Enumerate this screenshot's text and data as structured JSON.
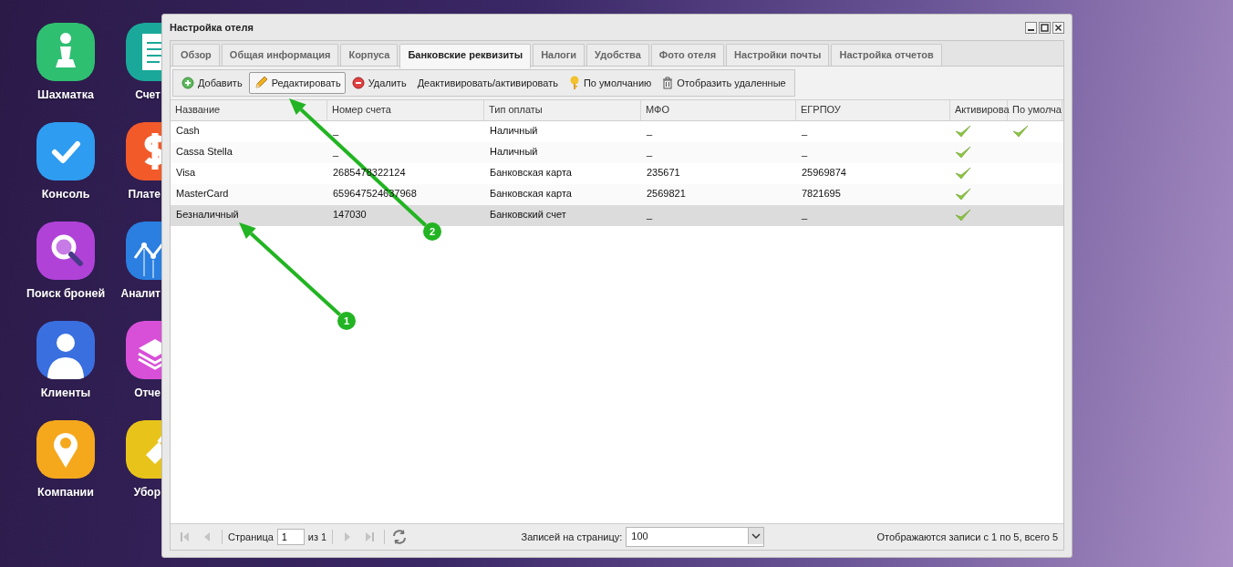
{
  "desktop": {
    "icons": [
      {
        "label": "Шахматка",
        "color": "#2fbf71"
      },
      {
        "label": "Счет",
        "color": "#1aa89a"
      },
      {
        "label": "Консоль",
        "color": "#2e9cf0"
      },
      {
        "label": "Плате",
        "color": "#f25a2a"
      },
      {
        "label": "Поиск броней",
        "color": "#b042d8"
      },
      {
        "label": "Аналит",
        "color": "#2a7fe0"
      },
      {
        "label": "Клиенты",
        "color": "#3a6fe0"
      },
      {
        "label": "Отче",
        "color": "#d84fd8"
      },
      {
        "label": "Компании",
        "color": "#f5a81c"
      },
      {
        "label": "Убор",
        "color": "#e8c41a"
      }
    ]
  },
  "window": {
    "title": "Настройка отеля",
    "tabs": [
      {
        "label": "Обзор",
        "selected": false
      },
      {
        "label": "Общая информация",
        "selected": false
      },
      {
        "label": "Корпуса",
        "selected": false
      },
      {
        "label": "Банковские реквизиты",
        "selected": true
      },
      {
        "label": "Налоги",
        "selected": false
      },
      {
        "label": "Удобства",
        "selected": false
      },
      {
        "label": "Фото отеля",
        "selected": false
      },
      {
        "label": "Настройки почты",
        "selected": false
      },
      {
        "label": "Настройка отчетов",
        "selected": false
      }
    ],
    "toolbar": [
      {
        "label": "Добавить",
        "pressed": false
      },
      {
        "label": "Редактировать",
        "pressed": true
      },
      {
        "label": "Удалить",
        "pressed": false
      },
      {
        "label": "Деактивировать/активировать",
        "pressed": false
      },
      {
        "label": "По умолчанию",
        "pressed": false
      },
      {
        "label": "Отобразить удаленные",
        "pressed": false
      }
    ],
    "table": {
      "columns": [
        "Название",
        "Номер счета",
        "Тип оплаты",
        "МФО",
        "ЕГРПОУ",
        "Активирова",
        "По умолча"
      ],
      "rows": [
        {
          "cells": [
            "Cash",
            "_",
            "Наличный",
            "_",
            "_"
          ],
          "active": true,
          "default": true,
          "selected": false
        },
        {
          "cells": [
            "Cassa Stella",
            "_",
            "Наличный",
            "_",
            "_"
          ],
          "active": true,
          "default": false,
          "selected": false
        },
        {
          "cells": [
            "Visa",
            "2685478322124",
            "Банковская карта",
            "235671",
            "25969874"
          ],
          "active": true,
          "default": false,
          "selected": false
        },
        {
          "cells": [
            "MasterCard",
            "659647524637968",
            "Банковская карта",
            "2569821",
            "7821695"
          ],
          "active": true,
          "default": false,
          "selected": false
        },
        {
          "cells": [
            "Безналичный",
            "147030",
            "Банковский счет",
            "_",
            "_"
          ],
          "active": true,
          "default": false,
          "selected": true
        }
      ]
    },
    "paging": {
      "page_label": "Страница",
      "page": "1",
      "of": "из 1",
      "page_size_label": "Записей на страницу:",
      "page_size": "100",
      "status": "Отображаются записи с 1 по 5, всего 5"
    }
  },
  "annotations": [
    {
      "number": "1"
    },
    {
      "number": "2"
    }
  ]
}
